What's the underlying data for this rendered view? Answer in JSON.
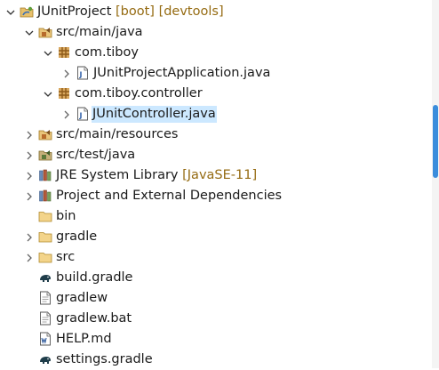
{
  "tree": {
    "root": {
      "name": "JUnitProject",
      "decoration": "[boot] [devtools]"
    },
    "src_main_java": {
      "label": "src/main/java"
    },
    "pkg_tiboy": {
      "label": "com.tiboy"
    },
    "file_app": {
      "label": "JUnitProjectApplication.java"
    },
    "pkg_controller": {
      "label": "com.tiboy.controller"
    },
    "file_controller": {
      "label": "JUnitController.java"
    },
    "src_main_resources": {
      "label": "src/main/resources"
    },
    "src_test_java": {
      "label": "src/test/java"
    },
    "jre": {
      "label": "JRE System Library",
      "decoration": "[JavaSE-11]"
    },
    "deps": {
      "label": "Project and External Dependencies"
    },
    "bin": {
      "label": "bin"
    },
    "gradle": {
      "label": "gradle"
    },
    "src": {
      "label": "src"
    },
    "build_gradle": {
      "label": "build.gradle"
    },
    "gradlew": {
      "label": "gradlew"
    },
    "gradlew_bat": {
      "label": "gradlew.bat"
    },
    "help_md": {
      "label": "HELP.md"
    },
    "settings_gradle": {
      "label": "settings.gradle"
    }
  },
  "selected_item": "JUnitController.java",
  "colors": {
    "selection": "#cce8ff",
    "decoration": "#956b12",
    "scroll_thumb": "#3b8ddc"
  }
}
